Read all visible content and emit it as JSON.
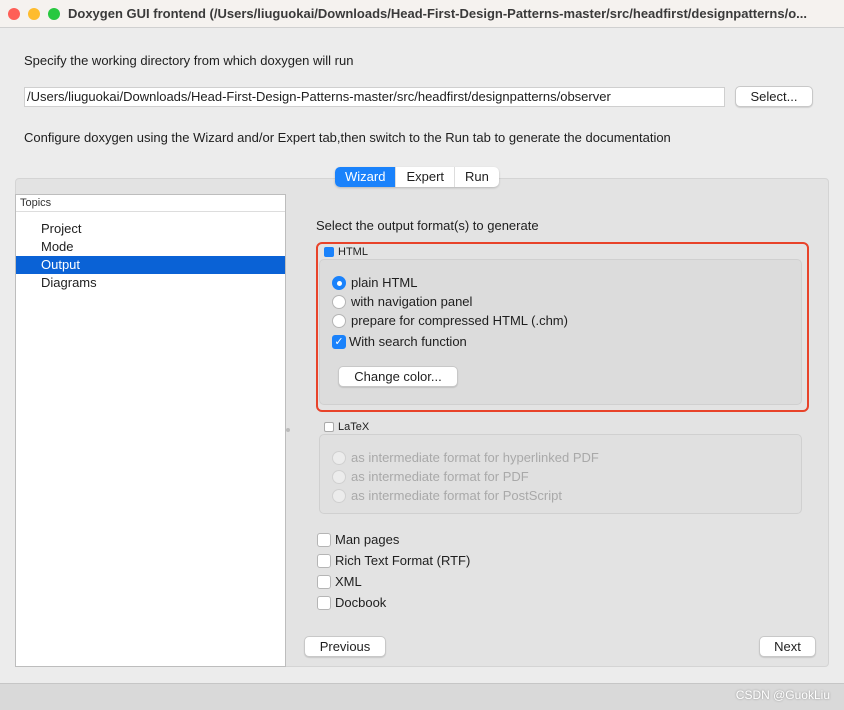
{
  "window": {
    "title": "Doxygen GUI frontend (/Users/liuguokai/Downloads/Head-First-Design-Patterns-master/src/headfirst/designpatterns/o...",
    "colors": {
      "close": "#fe5f57",
      "minimize": "#febc2e",
      "zoom": "#28c840",
      "accent": "#1a82fb",
      "highlight_box": "#e8432a"
    }
  },
  "workdir": {
    "label": "Specify the working directory from which doxygen will run",
    "value": "/Users/liuguokai/Downloads/Head-First-Design-Patterns-master/src/headfirst/designpatterns/observer",
    "select_label": "Select..."
  },
  "instructions": "Configure doxygen using the Wizard and/or Expert tab,then switch to the Run tab to generate the documentation",
  "tabs": [
    {
      "label": "Wizard",
      "active": true
    },
    {
      "label": "Expert",
      "active": false
    },
    {
      "label": "Run",
      "active": false
    }
  ],
  "topics": {
    "header": "Topics",
    "items": [
      {
        "label": "Project"
      },
      {
        "label": "Mode"
      },
      {
        "label": "Output",
        "selected": true
      },
      {
        "label": "Diagrams"
      }
    ]
  },
  "output": {
    "heading": "Select the output format(s) to generate",
    "html": {
      "label": "HTML",
      "checked": true,
      "options": [
        {
          "label": "plain HTML",
          "selected": true
        },
        {
          "label": "with navigation panel",
          "selected": false
        },
        {
          "label": "prepare for compressed HTML (.chm)",
          "selected": false
        }
      ],
      "search": {
        "label": "With search function",
        "checked": true
      },
      "change_color": "Change color..."
    },
    "latex": {
      "label": "LaTeX",
      "checked": false,
      "options": [
        {
          "label": "as intermediate format for hyperlinked PDF",
          "selected": true
        },
        {
          "label": "as intermediate format for PDF",
          "selected": false
        },
        {
          "label": "as intermediate format for PostScript",
          "selected": false
        }
      ]
    },
    "others": [
      {
        "label": "Man pages",
        "checked": false
      },
      {
        "label": "Rich Text Format (RTF)",
        "checked": false
      },
      {
        "label": "XML",
        "checked": false
      },
      {
        "label": "Docbook",
        "checked": false
      }
    ]
  },
  "nav": {
    "previous": "Previous",
    "next": "Next"
  },
  "watermark": "CSDN @GuokLiu"
}
